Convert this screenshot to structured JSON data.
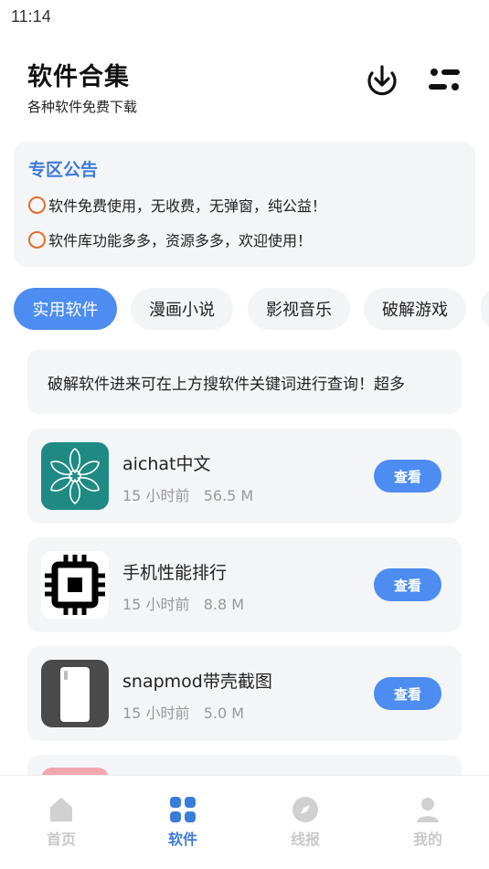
{
  "status_bar": {
    "time": "11:14"
  },
  "header": {
    "title": "软件合集",
    "subtitle": "各种软件免费下载",
    "download_icon": "download-icon",
    "filter_icon": "filter-icon"
  },
  "notice": {
    "title": "专区公告",
    "lines": [
      "软件免费使用，无收费，无弹窗，纯公益！",
      "软件库功能多多，资源多多，欢迎使用！"
    ],
    "bullet_color": "#e66a2a"
  },
  "tabs": [
    {
      "label": "实用软件",
      "active": true
    },
    {
      "label": "漫画小说",
      "active": false
    },
    {
      "label": "影视音乐",
      "active": false
    },
    {
      "label": "破解游戏",
      "active": false
    }
  ],
  "tip": {
    "text": "破解软件进来可在上方搜软件关键词进行查询！超多"
  },
  "apps": [
    {
      "name": "aichat中文",
      "time": "15 小时前",
      "size": "56.5 M",
      "button": "查看",
      "icon": "flower-icon"
    },
    {
      "name": "手机性能排行",
      "time": "15 小时前",
      "size": "8.8 M",
      "button": "查看",
      "icon": "cpu-chip-icon"
    },
    {
      "name": "snapmod带壳截图",
      "time": "15 小时前",
      "size": "5.0 M",
      "button": "查看",
      "icon": "phone-icon"
    }
  ],
  "bottom_nav": [
    {
      "label": "首页",
      "icon": "home-icon",
      "active": false
    },
    {
      "label": "软件",
      "icon": "grid-icon",
      "active": true
    },
    {
      "label": "线报",
      "icon": "compass-icon",
      "active": false
    },
    {
      "label": "我的",
      "icon": "user-icon",
      "active": false
    }
  ],
  "colors": {
    "accent": "#4d8cf0",
    "title_blue": "#3d7bd9",
    "card_bg": "#f4f5f7"
  }
}
